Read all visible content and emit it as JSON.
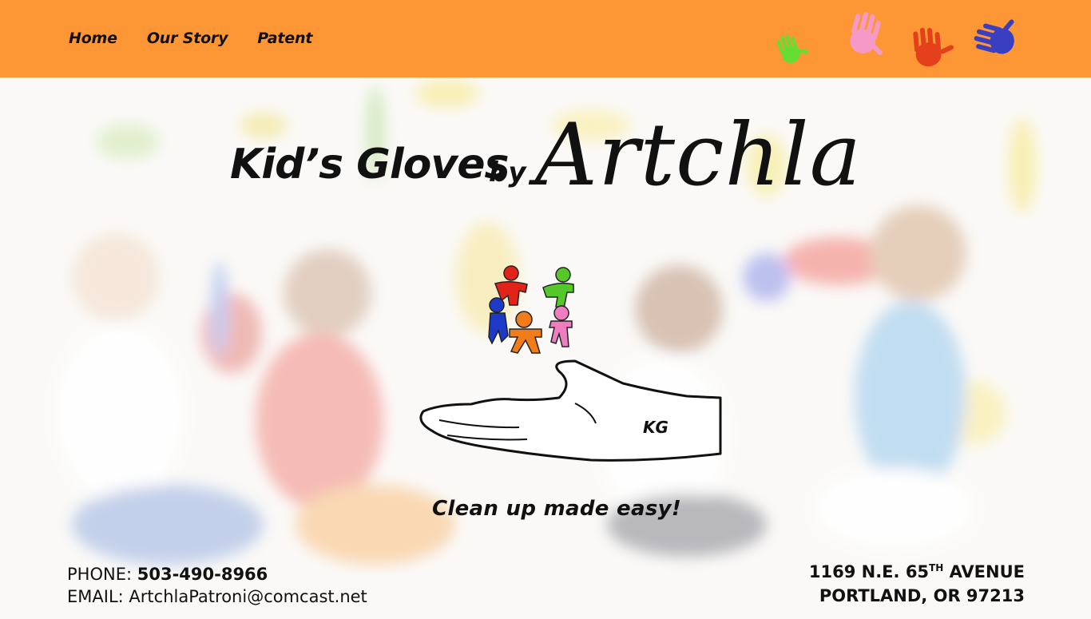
{
  "nav": {
    "items": [
      {
        "label": "Home"
      },
      {
        "label": "Our Story"
      },
      {
        "label": "Patent"
      }
    ]
  },
  "header": {
    "handprints": [
      {
        "color": "#66dd33",
        "name": "green-handprint-icon"
      },
      {
        "color": "#f59ac8",
        "name": "pink-handprint-icon"
      },
      {
        "color": "#e4401c",
        "name": "red-handprint-icon"
      },
      {
        "color": "#3a3fc2",
        "name": "blue-handprint-icon"
      }
    ]
  },
  "hero": {
    "title_small": "Kid’s Gloves",
    "title_by": "by",
    "title_big": "Artchla",
    "logo_text": "KG",
    "tagline": "Clean up made easy!"
  },
  "contact": {
    "phone_label": "PHONE:",
    "phone": "503-490-8966",
    "email_label": "EMAIL:",
    "email": "ArtchlaPatroni@comcast.net"
  },
  "address": {
    "line1_pre": "1169 N.E. 65",
    "line1_sup": "TH",
    "line1_post": " AVENUE",
    "line2": "PORTLAND, OR 97213"
  },
  "colors": {
    "header_bg": "#fd9735",
    "text": "#111111"
  }
}
